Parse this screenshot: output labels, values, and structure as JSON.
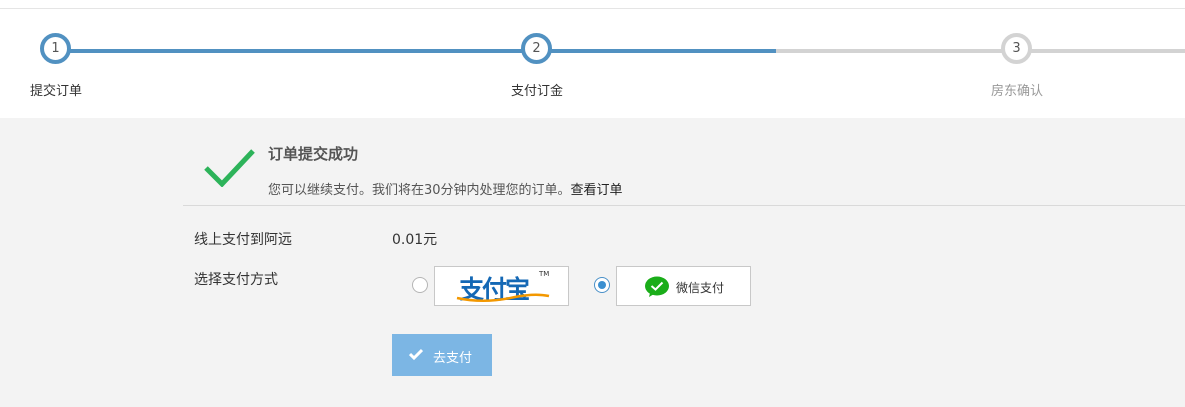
{
  "steps": [
    {
      "number": "1",
      "label": "提交订单",
      "state": "done"
    },
    {
      "number": "2",
      "label": "支付订金",
      "state": "done"
    },
    {
      "number": "3",
      "label": "房东确认",
      "state": "todo"
    }
  ],
  "success": {
    "title": "订单提交成功",
    "desc": "您可以继续支付。我们将在30分钟内处理您的订单。",
    "view_order": "查看订单"
  },
  "payment": {
    "to_label": "线上支付到阿远",
    "amount": "0.01元",
    "method_label": "选择支付方式",
    "options": [
      {
        "name": "支付宝",
        "tm": "TM",
        "selected": false
      },
      {
        "name": "微信支付",
        "selected": true
      }
    ],
    "button_label": "去支付"
  },
  "colors": {
    "accent": "#5191c1",
    "inactive": "#d3d3d3",
    "success_check": "#2db35a",
    "button": "#7cb6e4",
    "wechat_green": "#1aad19"
  }
}
